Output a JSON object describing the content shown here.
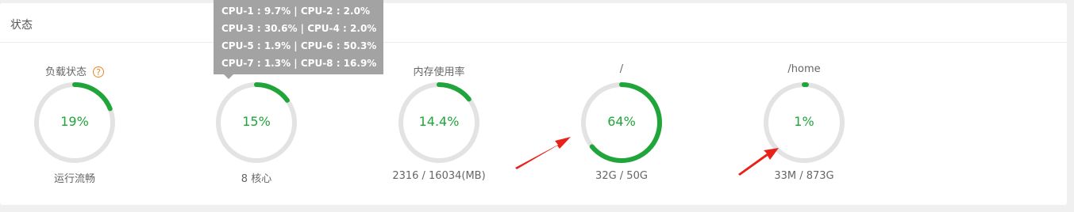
{
  "panel": {
    "title": "状态"
  },
  "gauges": [
    {
      "title": "负载状态",
      "value": "19%",
      "percent": 19,
      "sub": "运行流畅",
      "help_icon": "question-icon"
    },
    {
      "title": "",
      "value": "15%",
      "percent": 15,
      "sub": "8 核心"
    },
    {
      "title": "内存使用率",
      "value": "14.4%",
      "percent": 14.4,
      "sub": "2316 / 16034(MB)"
    },
    {
      "title": "/",
      "value": "64%",
      "percent": 64,
      "sub": "32G / 50G"
    },
    {
      "title": "/home",
      "value": "1%",
      "percent": 1,
      "sub": "33M / 873G"
    }
  ],
  "tooltip": {
    "lines": [
      "CPU-1 : 9.7% | CPU-2 : 2.0%",
      "CPU-3 : 30.6% | CPU-4 : 2.0%",
      "CPU-5 : 1.9% | CPU-6 : 50.3%",
      "CPU-7 : 1.3% | CPU-8 : 16.9%"
    ]
  },
  "colors": {
    "accent": "#20a53a",
    "track": "#e3e3e3",
    "help": "#e8862a",
    "tooltip_bg": "#a3a3a3",
    "annotation": "#e8221a"
  }
}
